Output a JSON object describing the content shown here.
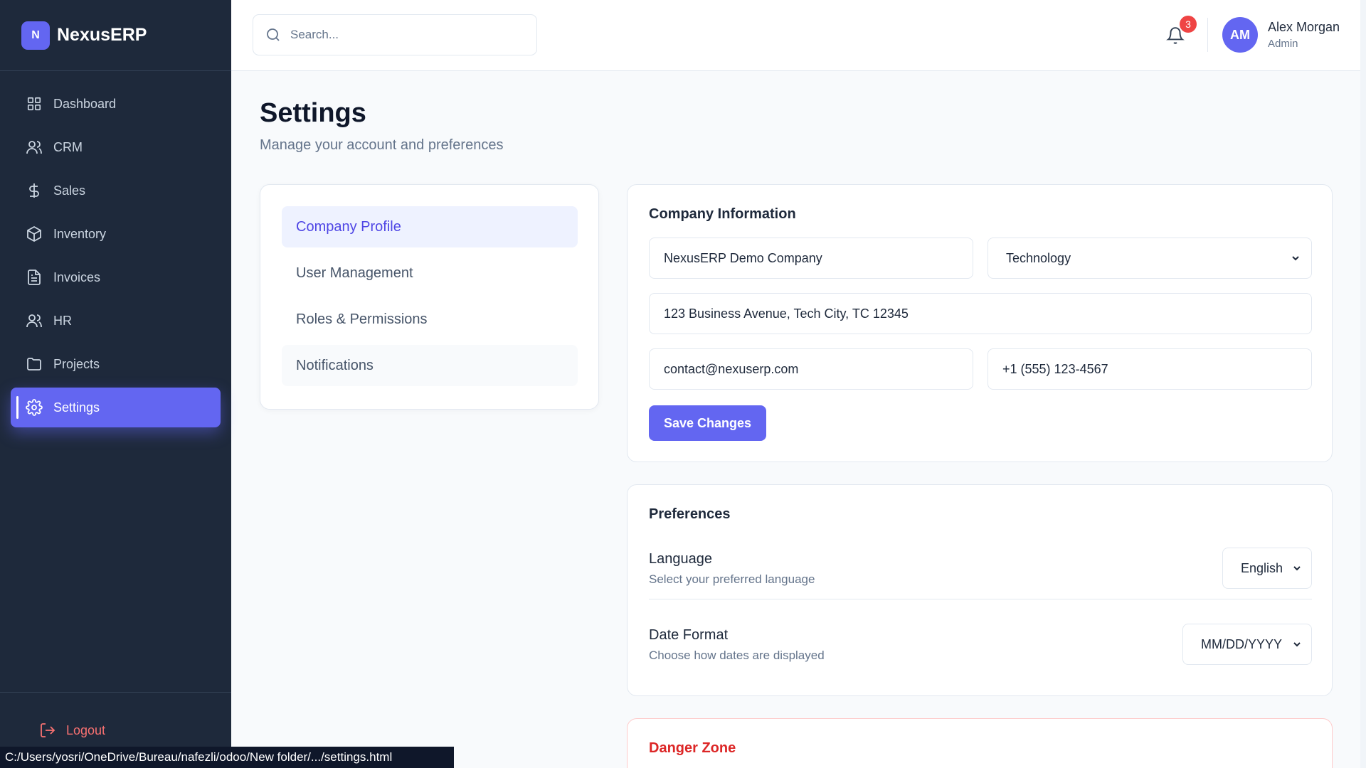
{
  "brand": {
    "logo_letter": "N",
    "name": "NexusERP",
    "accent": "#6366f1"
  },
  "sidebar": {
    "items": [
      {
        "label": "Dashboard",
        "icon": "grid-icon"
      },
      {
        "label": "CRM",
        "icon": "users-icon"
      },
      {
        "label": "Sales",
        "icon": "dollar-icon"
      },
      {
        "label": "Inventory",
        "icon": "box-icon"
      },
      {
        "label": "Invoices",
        "icon": "file-icon"
      },
      {
        "label": "HR",
        "icon": "users-icon"
      },
      {
        "label": "Projects",
        "icon": "folder-icon"
      },
      {
        "label": "Settings",
        "icon": "gear-icon",
        "active": true
      }
    ],
    "logout_label": "Logout"
  },
  "header": {
    "search_placeholder": "Search...",
    "notification_count": "3",
    "avatar_initials": "AM",
    "user_name": "Alex Morgan",
    "user_role": "Admin"
  },
  "page": {
    "title": "Settings",
    "subtitle": "Manage your account and preferences"
  },
  "settings_nav": {
    "items": [
      "Company Profile",
      "User Management",
      "Roles & Permissions",
      "Notifications"
    ],
    "active": "Company Profile"
  },
  "company": {
    "title": "Company Information",
    "company_name": "NexusERP Demo Company",
    "industry": "Technology",
    "address": "123 Business Avenue, Tech City, TC 12345",
    "email": "contact@nexuserp.com",
    "phone": "+1 (555) 123-4567",
    "save_label": "Save Changes"
  },
  "preferences": {
    "title": "Preferences",
    "language_label": "Language",
    "language_desc": "Select your preferred language",
    "language_value": "English",
    "date_label": "Date Format",
    "date_desc": "Choose how dates are displayed",
    "date_value": "MM/DD/YYYY"
  },
  "danger": {
    "title": "Danger Zone"
  },
  "statusbar": {
    "path": "C:/Users/yosri/OneDrive/Bureau/nafezli/odoo/New folder/.../settings.html"
  }
}
